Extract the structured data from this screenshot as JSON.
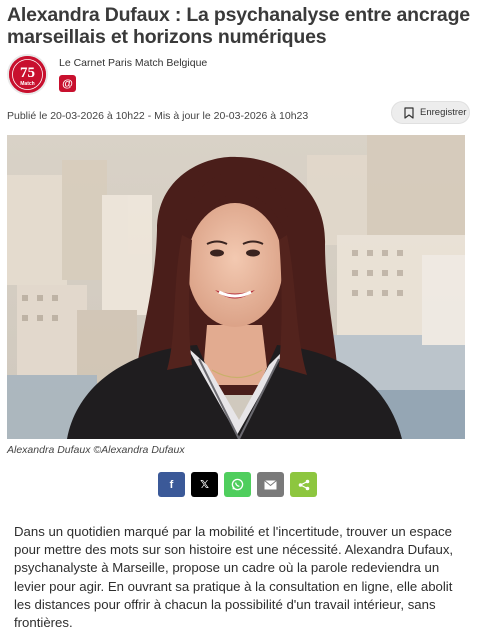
{
  "article": {
    "title": "Alexandra Dufaux : La psychanalyse entre ancrage marseillais et horizons numériques",
    "author": "Le Carnet Paris Match Belgique",
    "author_badge": "@",
    "logo_text": "75 Match",
    "meta": "Publié le 20-03-2026 à 10h22 - Mis à jour le 20-03-2026 à 10h23",
    "save_label": "Enregistrer",
    "photo_caption": "Alexandra Dufaux ©Alexandra Dufaux",
    "body": "Dans un quotidien marqué par la mobilité et l'incertitude, trouver un espace pour mettre des mots sur son histoire est une nécessité. Alexandra Dufaux, psychanalyste à Marseille, propose un cadre où la parole redeviendra un levier pour agir. En ouvrant sa pratique à la consultation en ligne, elle abolit les distances pour offrir à chacun la possibilité d'un travail intérieur, sans frontières."
  },
  "share": {
    "facebook": "f",
    "x": "𝕏",
    "whatsapp_icon": "whatsapp-icon",
    "mail_icon": "mail-icon",
    "share_icon": "share-icon"
  },
  "colors": {
    "brand_red": "#c8102e",
    "facebook": "#3b5998",
    "x": "#000000",
    "whatsapp": "#4fce5d",
    "mail": "#7a7a7a",
    "share": "#8dc63f"
  }
}
